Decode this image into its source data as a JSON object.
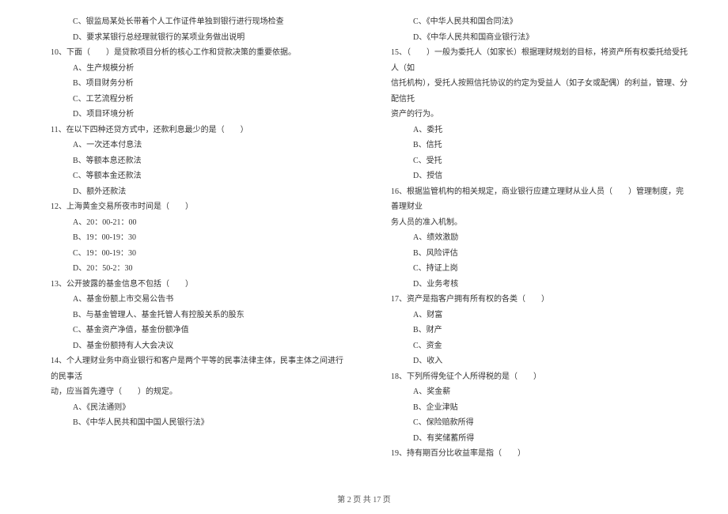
{
  "left_column": {
    "lines": [
      {
        "cls": "indent-opt",
        "text": "C、银监局某处长带着个人工作证件单独到银行进行现场检查"
      },
      {
        "cls": "indent-opt",
        "text": "D、要求某银行总经理就银行的某项业务做出说明"
      },
      {
        "cls": "indent-q",
        "text": "10、下面（　　）是贷款项目分析的核心工作和贷款决策的重要依据。"
      },
      {
        "cls": "indent-opt",
        "text": "A、生产规模分析"
      },
      {
        "cls": "indent-opt",
        "text": "B、项目财务分析"
      },
      {
        "cls": "indent-opt",
        "text": "C、工艺流程分析"
      },
      {
        "cls": "indent-opt",
        "text": "D、项目环境分析"
      },
      {
        "cls": "indent-q",
        "text": "11、在以下四种还贷方式中，还款利息最少的是（　　）"
      },
      {
        "cls": "indent-opt",
        "text": "A、一次还本付息法"
      },
      {
        "cls": "indent-opt",
        "text": "B、等额本息还款法"
      },
      {
        "cls": "indent-opt",
        "text": "C、等额本金还款法"
      },
      {
        "cls": "indent-opt",
        "text": "D、额外还款法"
      },
      {
        "cls": "indent-q",
        "text": "12、上海黄金交易所夜市时间是（　　）"
      },
      {
        "cls": "indent-opt",
        "text": "A、20：00-21：00"
      },
      {
        "cls": "indent-opt",
        "text": "B、19：00-19：30"
      },
      {
        "cls": "indent-opt",
        "text": "C、19：00-19：30"
      },
      {
        "cls": "indent-opt",
        "text": "D、20：50-2：30"
      },
      {
        "cls": "indent-q",
        "text": "13、公开披露的基金信息不包括（　　）"
      },
      {
        "cls": "indent-opt",
        "text": "A、基金份额上市交易公告书"
      },
      {
        "cls": "indent-opt",
        "text": "B、与基金管理人、基金托管人有控股关系的股东"
      },
      {
        "cls": "indent-opt",
        "text": "C、基金资产净值，基金份额净值"
      },
      {
        "cls": "indent-opt",
        "text": "D、基金份额持有人大会决议"
      },
      {
        "cls": "indent-q",
        "text": "14、个人理财业务中商业银行和客户是两个平等的民事法律主体，民事主体之间进行的民事活"
      },
      {
        "cls": "indent-cont",
        "text": "动，应当首先遵守（　　）的规定。"
      },
      {
        "cls": "indent-opt",
        "text": "A、《民法通则》"
      },
      {
        "cls": "indent-opt",
        "text": "B、《中华人民共和国中国人民银行法》"
      }
    ]
  },
  "right_column": {
    "lines": [
      {
        "cls": "indent-opt",
        "text": "C、《中华人民共和国合同法》"
      },
      {
        "cls": "indent-opt",
        "text": "D、《中华人民共和国商业银行法》"
      },
      {
        "cls": "indent-q",
        "text": "15、（　　）一般为委托人（如家长）根据理财规划的目标，将资产所有权委托给受托人（如"
      },
      {
        "cls": "indent-cont",
        "text": "信托机构），受托人按照信托协议的约定为受益人（如子女或配偶）的利益，管理、分配信托"
      },
      {
        "cls": "indent-cont",
        "text": "资产的行为。"
      },
      {
        "cls": "indent-opt",
        "text": "A、委托"
      },
      {
        "cls": "indent-opt",
        "text": "B、信托"
      },
      {
        "cls": "indent-opt",
        "text": "C、受托"
      },
      {
        "cls": "indent-opt",
        "text": "D、授信"
      },
      {
        "cls": "indent-q",
        "text": "16、根据监管机构的相关规定，商业银行应建立理财从业人员（　　）管理制度，完善理财业"
      },
      {
        "cls": "indent-cont",
        "text": "务人员的准入机制。"
      },
      {
        "cls": "indent-opt",
        "text": "A、绩效激励"
      },
      {
        "cls": "indent-opt",
        "text": "B、风险评估"
      },
      {
        "cls": "indent-opt",
        "text": "C、持证上岗"
      },
      {
        "cls": "indent-opt",
        "text": "D、业务考核"
      },
      {
        "cls": "indent-q",
        "text": "17、资产是指客户拥有所有权的各类（　　）"
      },
      {
        "cls": "indent-opt",
        "text": "A、财富"
      },
      {
        "cls": "indent-opt",
        "text": "B、财产"
      },
      {
        "cls": "indent-opt",
        "text": "C、资金"
      },
      {
        "cls": "indent-opt",
        "text": "D、收入"
      },
      {
        "cls": "indent-q",
        "text": "18、下列所得免征个人所得税的是（　　）"
      },
      {
        "cls": "indent-opt",
        "text": "A、奖金薪"
      },
      {
        "cls": "indent-opt",
        "text": "B、企业津贴"
      },
      {
        "cls": "indent-opt",
        "text": "C、保险赔款所得"
      },
      {
        "cls": "indent-opt",
        "text": "D、有奖储蓄所得"
      },
      {
        "cls": "indent-q",
        "text": "19、持有期百分比收益率是指（　　）"
      }
    ]
  },
  "footer": "第 2 页 共 17 页"
}
